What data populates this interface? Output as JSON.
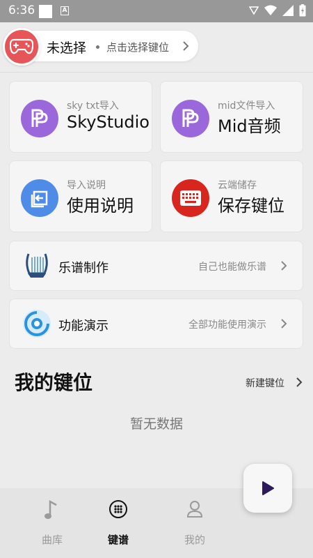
{
  "status_bar": {
    "time": "6:36",
    "notification_icon": "A"
  },
  "selector": {
    "title": "未选择",
    "hint": "点击选择键位"
  },
  "cards": [
    {
      "sub": "sky txt导入",
      "main": "SkyStudio",
      "icon": "pp-logo-icon",
      "color": "#9b68db"
    },
    {
      "sub": "mid文件导入",
      "main": "Mid音频",
      "icon": "pp-logo-icon",
      "color": "#9b68db"
    },
    {
      "sub": "导入说明",
      "main": "使用说明",
      "icon": "import-icon",
      "color": "#4f8ce8"
    },
    {
      "sub": "云端储存",
      "main": "保存键位",
      "icon": "keyboard-icon",
      "color": "#d8251d"
    }
  ],
  "rows": [
    {
      "label": "乐谱制作",
      "hint": "自己也能做乐谱",
      "icon": "lyre-icon"
    },
    {
      "label": "功能演示",
      "hint": "全部功能使用演示",
      "icon": "demo-icon"
    }
  ],
  "my_keys": {
    "title": "我的键位",
    "new_label": "新建键位",
    "empty_text": "暂无数据"
  },
  "tabs": [
    {
      "label": "曲库",
      "icon": "music-note-icon"
    },
    {
      "label": "键谱",
      "icon": "keypad-icon",
      "active": true
    },
    {
      "label": "我的",
      "icon": "person-icon"
    }
  ],
  "colors": {
    "accent_red": "#e65558",
    "purple": "#9b68db",
    "blue": "#4f8ce8",
    "fab_play": "#2c1a5c"
  }
}
